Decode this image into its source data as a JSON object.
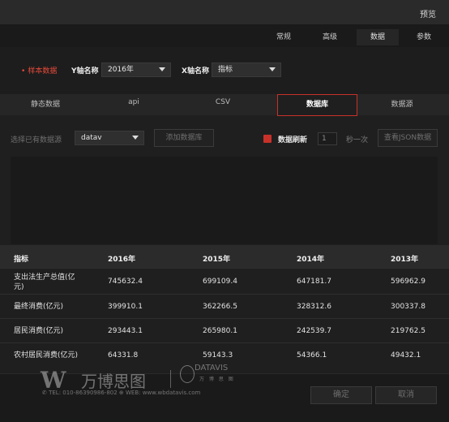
{
  "header": {
    "preview_label": "预览"
  },
  "top_tabs": [
    {
      "label": "常规"
    },
    {
      "label": "高级"
    },
    {
      "label": "数据"
    },
    {
      "label": "参数"
    }
  ],
  "fields": {
    "sample_label": "样本数据",
    "y_label": "Y轴名称",
    "y_value": "2016年",
    "x_label": "X轴名称",
    "x_value": "指标"
  },
  "source_tabs": [
    {
      "label": "静态数据"
    },
    {
      "label": "api"
    },
    {
      "label": "CSV"
    },
    {
      "label": "数据库"
    },
    {
      "label": "数据源"
    }
  ],
  "datasource": {
    "select_label": "选择已有数据源",
    "selected": "datav",
    "add_button": "添加数据库",
    "refresh_label": "数据刷新",
    "refresh_value": "1",
    "per_second": "秒一次",
    "view_json_button": "查看JSON数据"
  },
  "table": {
    "headers": [
      "指标",
      "2016年",
      "2015年",
      "2014年",
      "2013年"
    ],
    "rows": [
      [
        "支出法生产总值(亿",
        "745632.4",
        "699109.4",
        "647181.7",
        "596962.9"
      ],
      [
        "最终消费(亿元)",
        "399910.1",
        "362266.5",
        "328312.6",
        "300337.8"
      ],
      [
        "居民消费(亿元)",
        "293443.1",
        "265980.1",
        "242539.7",
        "219762.5"
      ],
      [
        "农村居民消费(亿元)",
        "64331.8",
        "59143.3",
        "54366.1",
        "49432.1"
      ]
    ],
    "row0_wrap": "元)"
  },
  "footer": {
    "confirm": "确定",
    "cancel": "取消"
  },
  "watermark": {
    "brand_cn": "万博思图",
    "brand_en": "DATAVIS",
    "brand_en_sub": "万 博 思 图",
    "contact": "✆ TEL: 010-86390986-802  ⊕ WEB: www.wbdatavis.com"
  }
}
